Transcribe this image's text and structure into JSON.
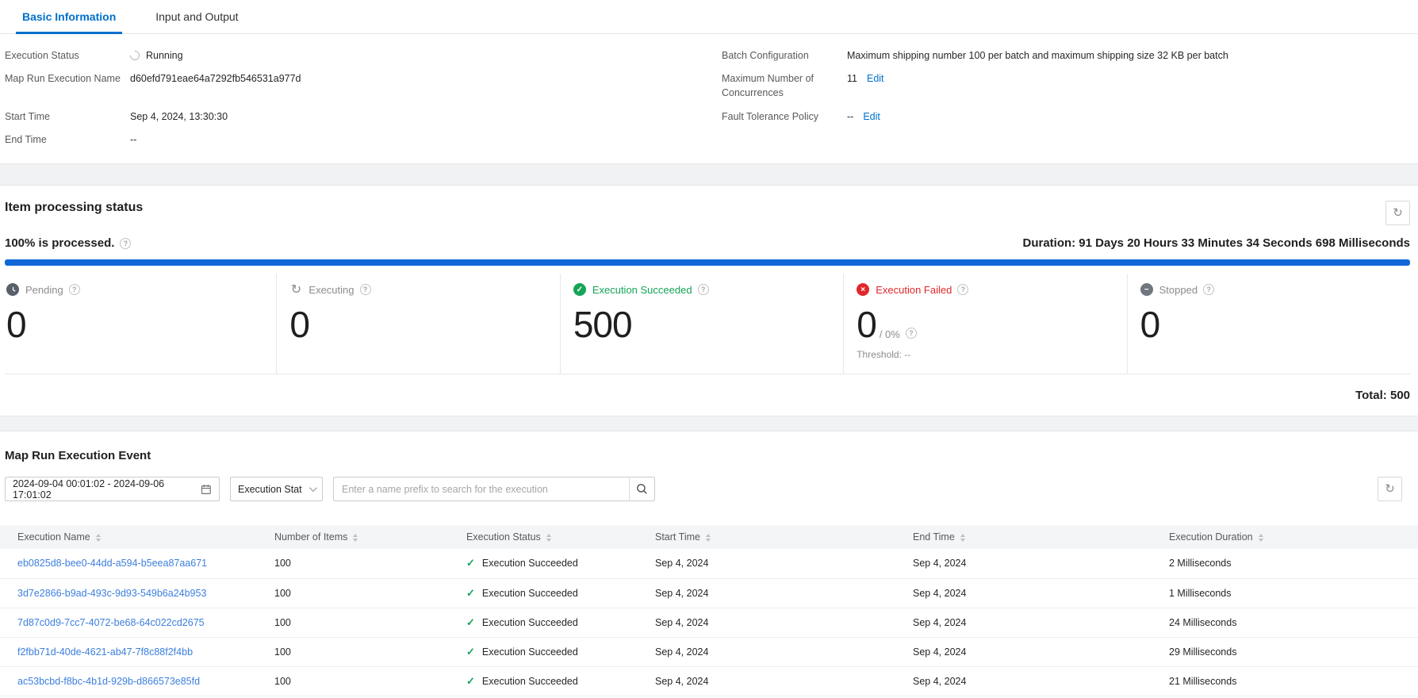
{
  "colors": {
    "accent": "#0070cc",
    "link": "#3d7fde",
    "progress": "#1268d8",
    "success": "#16a457",
    "error": "#e0282c",
    "pending-icon": "#596069",
    "muted-icon": "#70767d",
    "text": "#262626",
    "label": "#595959",
    "faint": "#8c8c8c",
    "border": "#e6e6e6",
    "band": "#f1f2f4",
    "thead": "#f4f5f6"
  },
  "icons": {
    "refresh": "↻",
    "check": "✓",
    "cross": "×",
    "minus": "−",
    "question": "?"
  },
  "tabs": {
    "basic": "Basic Information",
    "io": "Input and Output"
  },
  "basic_info": {
    "left": [
      {
        "label": "Execution Status",
        "value": "Running"
      },
      {
        "label": "Map Run Execution Name",
        "value": "d60efd791eae64a7292fb546531a977d"
      },
      {
        "label": "Start Time",
        "value": "Sep 4, 2024, 13:30:30"
      },
      {
        "label": "End Time",
        "value": "--"
      }
    ],
    "right": [
      {
        "label": "Batch Configuration",
        "value": "Maximum shipping number 100 per batch and maximum shipping size 32 KB per batch"
      },
      {
        "label": "Maximum Number of Concurrences",
        "value": "11",
        "edit": "Edit"
      },
      {
        "label": "Fault Tolerance Policy",
        "value": "--",
        "edit": "Edit"
      }
    ]
  },
  "processing": {
    "title": "Item processing status",
    "progress_text": "100% is processed.",
    "progress_percent": 100,
    "duration_text": "Duration: 91 Days 20 Hours 33 Minutes 34 Seconds 698 Milliseconds",
    "cards": [
      {
        "label": "Pending",
        "value": "0"
      },
      {
        "label": "Executing",
        "value": "0"
      },
      {
        "label": "Execution Succeeded",
        "value": "500"
      },
      {
        "label": "Execution Failed",
        "value": "0",
        "suffix": "/ 0%",
        "threshold": "Threshold: --"
      },
      {
        "label": "Stopped",
        "value": "0"
      }
    ],
    "total_text": "Total: 500"
  },
  "events": {
    "title": "Map Run Execution Event",
    "date_range": "2024-09-04 00:01:02 - 2024-09-06 17:01:02",
    "status_filter": "Execution Stat",
    "search_placeholder": "Enter a name prefix to search for the execution",
    "table": {
      "columns": [
        "Execution Name",
        "Number of Items",
        "Execution Status",
        "Start Time",
        "End Time",
        "Execution Duration"
      ],
      "rows": [
        {
          "name": "eb0825d8-bee0-44dd-a594-b5eea87aa671",
          "items": "100",
          "status": "Execution Succeeded",
          "start": "Sep 4, 2024",
          "end": "Sep 4, 2024",
          "duration": "2 Milliseconds"
        },
        {
          "name": "3d7e2866-b9ad-493c-9d93-549b6a24b953",
          "items": "100",
          "status": "Execution Succeeded",
          "start": "Sep 4, 2024",
          "end": "Sep 4, 2024",
          "duration": "1 Milliseconds"
        },
        {
          "name": "7d87c0d9-7cc7-4072-be68-64c022cd2675",
          "items": "100",
          "status": "Execution Succeeded",
          "start": "Sep 4, 2024",
          "end": "Sep 4, 2024",
          "duration": "24 Milliseconds"
        },
        {
          "name": "f2fbb71d-40de-4621-ab47-7f8c88f2f4bb",
          "items": "100",
          "status": "Execution Succeeded",
          "start": "Sep 4, 2024",
          "end": "Sep 4, 2024",
          "duration": "29 Milliseconds"
        },
        {
          "name": "ac53bcbd-f8bc-4b1d-929b-d866573e85fd",
          "items": "100",
          "status": "Execution Succeeded",
          "start": "Sep 4, 2024",
          "end": "Sep 4, 2024",
          "duration": "21 Milliseconds"
        }
      ]
    }
  }
}
